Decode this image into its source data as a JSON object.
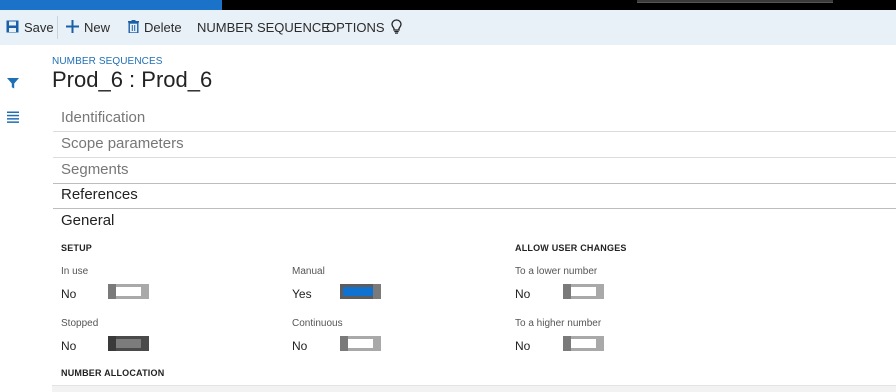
{
  "action_pane": {
    "save": "Save",
    "new": "New",
    "delete": "Delete",
    "number_sequence": "NUMBER SEQUENCE",
    "options": "OPTIONS"
  },
  "page": {
    "caption": "NUMBER SEQUENCES",
    "title": "Prod_6 : Prod_6"
  },
  "fasttabs": [
    "Identification",
    "Scope parameters",
    "Segments",
    "References",
    "General"
  ],
  "general": {
    "setup_header": "SETUP",
    "allow_header": "ALLOW USER CHANGES",
    "allocation_header": "NUMBER ALLOCATION",
    "fields": {
      "in_use": {
        "label": "In use",
        "value": "No",
        "on": false
      },
      "manual": {
        "label": "Manual",
        "value": "Yes",
        "on": true
      },
      "to_lower": {
        "label": "To a lower number",
        "value": "No",
        "on": false
      },
      "stopped": {
        "label": "Stopped",
        "value": "No",
        "on": false
      },
      "continuous": {
        "label": "Continuous",
        "value": "No",
        "on": false
      },
      "to_higher": {
        "label": "To a higher number",
        "value": "No",
        "on": false
      }
    }
  },
  "colors": {
    "accent": "#1072d0",
    "action_pane": "#e8f0f8",
    "caption": "#1f6fb5"
  }
}
